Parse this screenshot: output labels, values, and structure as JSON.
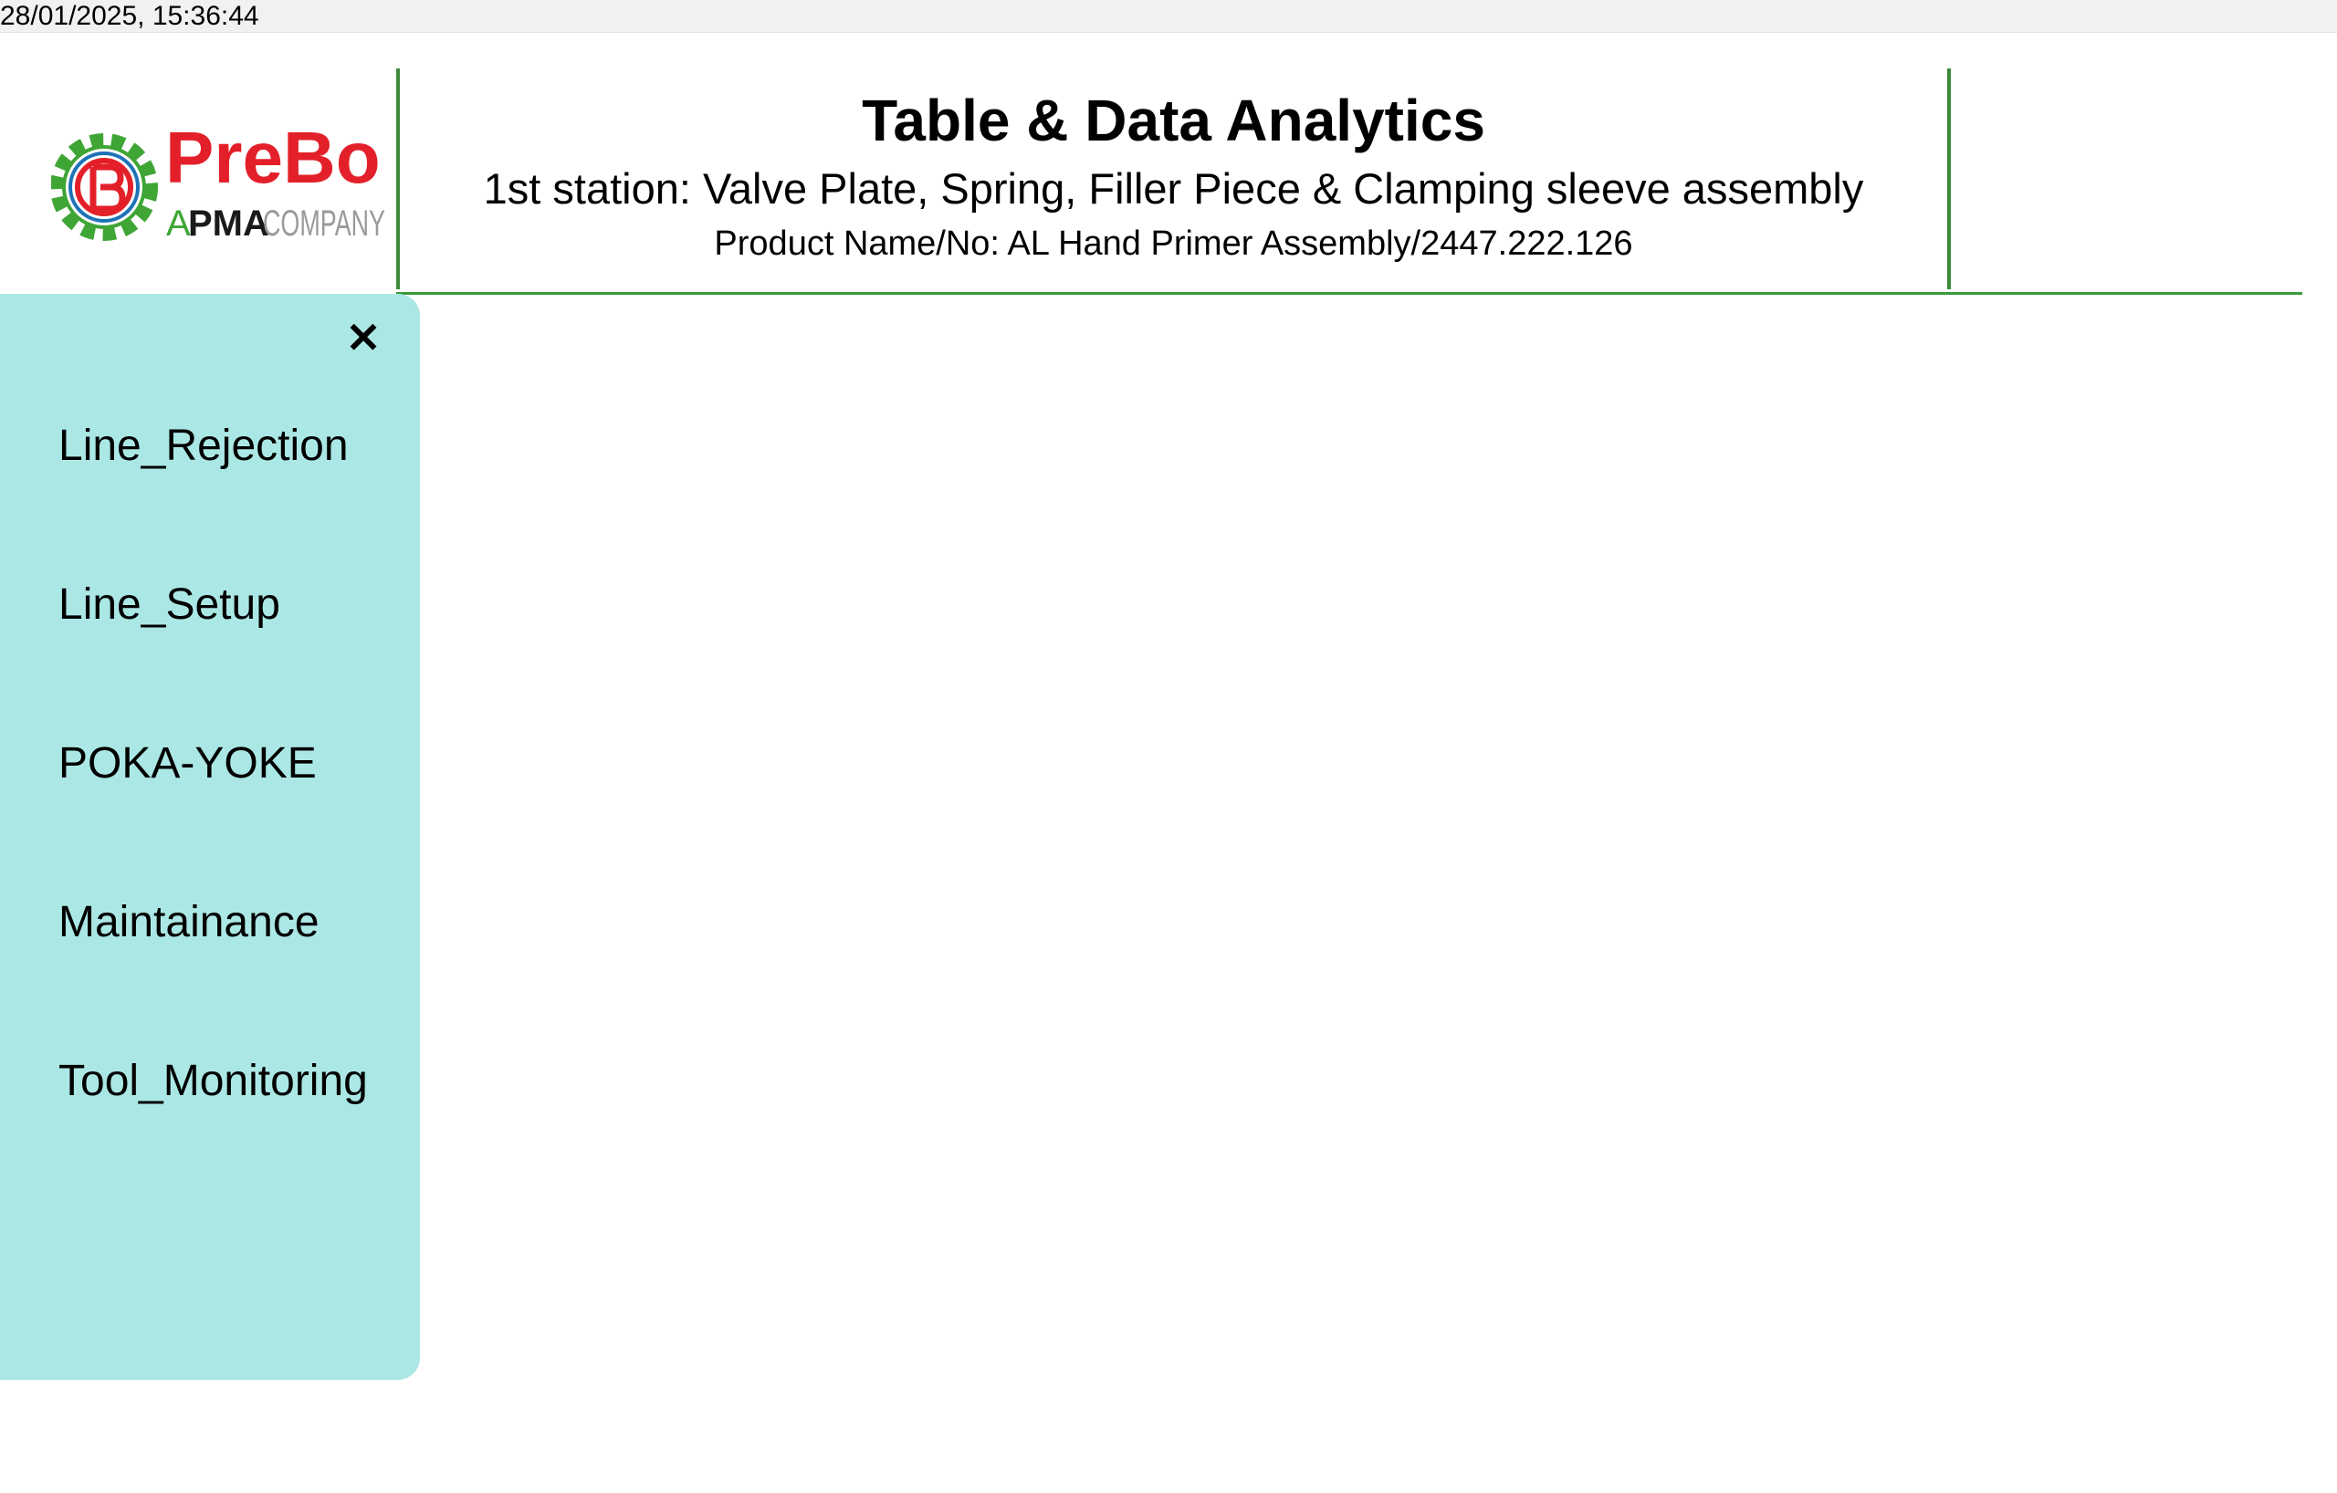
{
  "topbar": {
    "timestamp": "28/01/2025, 15:36:44"
  },
  "logo": {
    "brand": "PreBo",
    "tagline_a": "A",
    "tagline_pma": "PMA",
    "tagline_company": "COMPANY",
    "colors": {
      "red": "#e3202a",
      "green": "#3fa535",
      "blue": "#1e73b8"
    }
  },
  "header": {
    "title": "Table & Data Analytics",
    "subtitle": "1st station: Valve Plate, Spring, Filler Piece & Clamping sleeve assembly",
    "product": "Product Name/No: AL Hand Primer Assembly/2447.222.126",
    "border_color": "#3a8a3a"
  },
  "sidebar": {
    "background": "#abe8e5",
    "close_icon": "close-icon",
    "close_glyph": "✕",
    "items": [
      {
        "label": "Line_Rejection"
      },
      {
        "label": "Line_Setup"
      },
      {
        "label": "POKA-YOKE"
      },
      {
        "label": "Maintainance"
      },
      {
        "label": "Tool_Monitoring"
      }
    ]
  }
}
